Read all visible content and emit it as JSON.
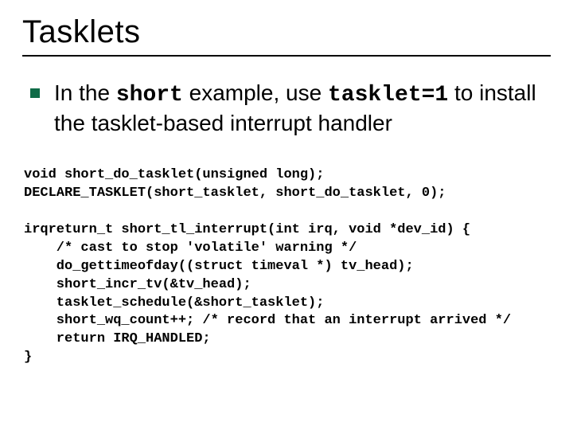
{
  "title": "Tasklets",
  "bullet": {
    "prefix": "In the ",
    "code1": "short",
    "mid": " example, use ",
    "code2": "tasklet=1",
    "suffix": " to install the tasklet-based interrupt handler"
  },
  "code_lines": [
    "void short_do_tasklet(unsigned long);",
    "DECLARE_TASKLET(short_tasklet, short_do_tasklet, 0);",
    "",
    "irqreturn_t short_tl_interrupt(int irq, void *dev_id) {",
    "    /* cast to stop 'volatile' warning */",
    "    do_gettimeofday((struct timeval *) tv_head);",
    "    short_incr_tv(&tv_head);",
    "    tasklet_schedule(&short_tasklet);",
    "    short_wq_count++; /* record that an interrupt arrived */",
    "    return IRQ_HANDLED;",
    "}"
  ]
}
